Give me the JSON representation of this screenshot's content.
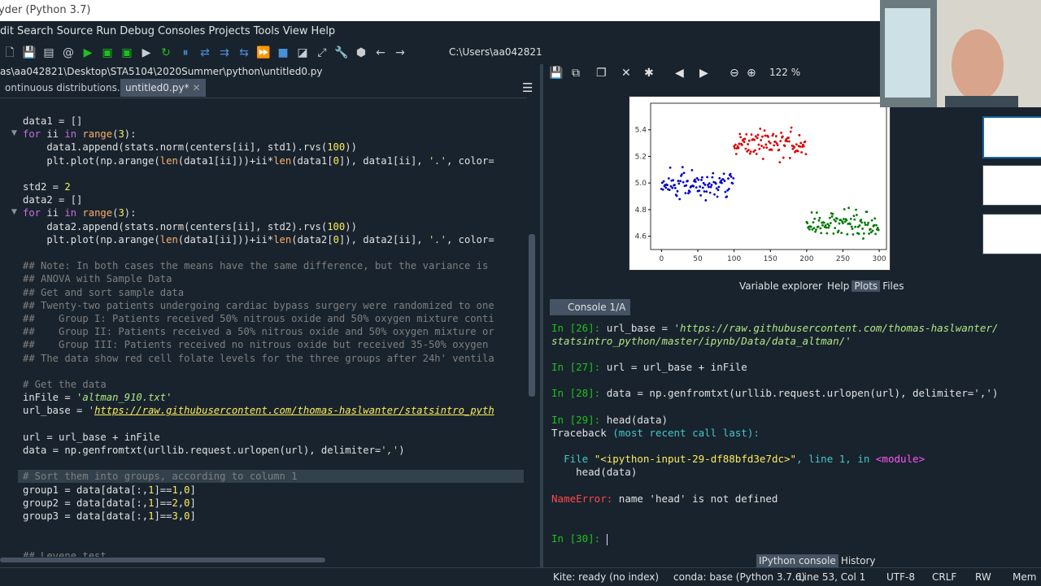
{
  "window": {
    "title": "yder (Python 3.7)"
  },
  "menu": [
    "dit",
    "Search",
    "Source",
    "Run",
    "Debug",
    "Consoles",
    "Projects",
    "Tools",
    "View",
    "Help"
  ],
  "toolbar": {
    "path": "C:\\Users\\aa042821"
  },
  "file_path": "as\\aa042821\\Desktop\\STA5104\\2020Summer\\python\\untitled0.py",
  "tabs": [
    {
      "label": "ontinuous distributions.py"
    },
    {
      "label": "untitled0.py*"
    }
  ],
  "editor": {
    "lines": [
      "data1 = []",
      "for ii in range(3):",
      "    data1.append(stats.norm(centers[ii], std1).rvs(100))",
      "    plt.plot(np.arange(len(data1[ii]))+ii*len(data1[0]), data1[ii], '.', color=",
      "",
      "std2 = 2",
      "data2 = []",
      "for ii in range(3):",
      "    data2.append(stats.norm(centers[ii], std2).rvs(100))",
      "    plt.plot(np.arange(len(data1[ii]))+ii*len(data2[0]), data2[ii], '.', color=",
      "",
      "## Note: In both cases the means have the same difference, but the variance is",
      "## ANOVA with Sample Data",
      "## Get and sort sample data",
      "## Twenty-two patients undergoing cardiac bypass surgery were randomized to one",
      "##    Group I: Patients received 50% nitrous oxide and 50% oxygen mixture conti",
      "##    Group II: Patients received a 50% nitrous oxide and 50% oxygen mixture or",
      "##    Group III: Patients received no nitrous oxide but received 35-50% oxygen",
      "## The data show red cell folate levels for the three groups after 24h' ventila",
      "",
      "# Get the data",
      "inFile = 'altman_910.txt'",
      "url_base = 'https://raw.githubusercontent.com/thomas-haslwanter/statsintro_pyth",
      "",
      "url = url_base + inFile",
      "data = np.genfromtxt(urllib.request.urlopen(url), delimiter=',')",
      "",
      "# Sort them into groups, according to column 1",
      "group1 = data[data[:,1]==1,0]",
      "group2 = data[data[:,1]==2,0]",
      "group3 = data[data[:,1]==3,0]",
      "",
      "",
      "## Levene test"
    ]
  },
  "plots": {
    "zoom": "122 %",
    "tabs": [
      "Variable explorer",
      "Help",
      "Plots",
      "Files"
    ],
    "active_tab": "Plots"
  },
  "chart_data": {
    "type": "scatter",
    "title": "",
    "xlabel": "",
    "ylabel": "",
    "xlim": [
      -15,
      310
    ],
    "ylim": [
      4.5,
      5.6
    ],
    "xticks": [
      0,
      50,
      100,
      150,
      200,
      250,
      300
    ],
    "yticks": [
      4.6,
      4.8,
      5.0,
      5.2,
      5.4
    ],
    "series": [
      {
        "color": "#0000cc",
        "x_range": [
          0,
          100
        ],
        "center": 5.0,
        "spread": 0.07
      },
      {
        "color": "#dd0000",
        "x_range": [
          100,
          200
        ],
        "center": 5.3,
        "spread": 0.07
      },
      {
        "color": "#007700",
        "x_range": [
          200,
          300
        ],
        "center": 4.7,
        "spread": 0.07
      }
    ]
  },
  "console": {
    "tab_label": "Console 1/A",
    "lines": [
      {
        "kind": "in",
        "n": "26",
        "code": "url_base = ",
        "str": "'https://raw.githubusercontent.com/thomas-haslwanter/"
      },
      {
        "kind": "cont",
        "str": "statsintro_python/master/ipynb/Data/data_altman/'"
      },
      {
        "kind": "in",
        "n": "27",
        "code": "url = url_base + inFile"
      },
      {
        "kind": "in",
        "n": "28",
        "code": "data = np.genfromtxt(urllib.request.urlopen(url), delimiter=',')"
      },
      {
        "kind": "in",
        "n": "29",
        "code": "head(data)"
      },
      {
        "kind": "tb",
        "text": "Traceback ",
        "paren": "(most recent call last):"
      },
      {
        "kind": "file",
        "pre": "File ",
        "file": "\"<ipython-input-29-df88bfd3e7dc>\"",
        "mid": ", line 1, in ",
        "mod": "<module>"
      },
      {
        "kind": "plain",
        "text": "    head(data)"
      },
      {
        "kind": "error",
        "name": "NameError:",
        "msg": " name 'head' is not defined"
      },
      {
        "kind": "in",
        "n": "30",
        "code": ""
      }
    ],
    "bottom_tabs": [
      "IPython console",
      "History"
    ],
    "active_bottom_tab": "IPython console"
  },
  "status": {
    "kite": "Kite: ready (no index)",
    "conda": "conda: base (Python 3.7.6)",
    "position": "Line 53, Col 1",
    "encoding": "UTF-8",
    "eol": "CRLF",
    "perm": "RW",
    "mem": "Mem"
  }
}
